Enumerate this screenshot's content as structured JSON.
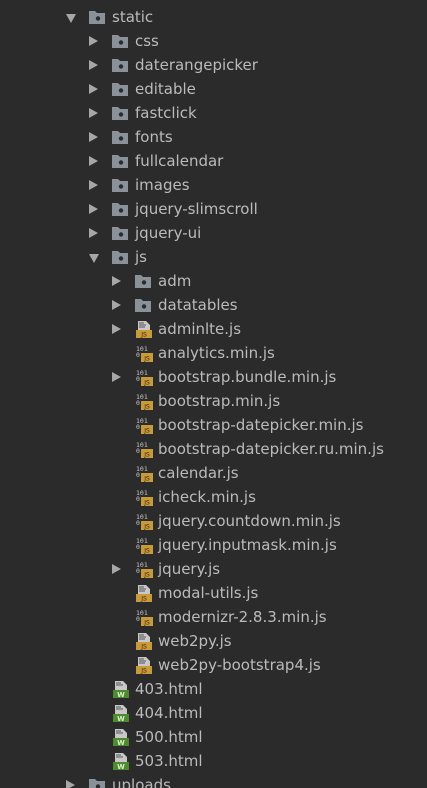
{
  "colors": {
    "background": "#2b2b2b",
    "text": "#bbbbbb",
    "arrow": "#a7a7a7",
    "folder": "#8a9199",
    "js_badge": "#c99a3b",
    "html_badge": "#4e8a2f"
  },
  "rows": [
    {
      "label": "static",
      "type": "folder",
      "state": "expanded",
      "depth": 0,
      "icon": "folder-icon"
    },
    {
      "label": "css",
      "type": "folder",
      "state": "collapsed",
      "depth": 1,
      "icon": "folder-icon"
    },
    {
      "label": "daterangepicker",
      "type": "folder",
      "state": "collapsed",
      "depth": 1,
      "icon": "folder-icon"
    },
    {
      "label": "editable",
      "type": "folder",
      "state": "collapsed",
      "depth": 1,
      "icon": "folder-icon"
    },
    {
      "label": "fastclick",
      "type": "folder",
      "state": "collapsed",
      "depth": 1,
      "icon": "folder-icon"
    },
    {
      "label": "fonts",
      "type": "folder",
      "state": "collapsed",
      "depth": 1,
      "icon": "folder-icon"
    },
    {
      "label": "fullcalendar",
      "type": "folder",
      "state": "collapsed",
      "depth": 1,
      "icon": "folder-icon"
    },
    {
      "label": "images",
      "type": "folder",
      "state": "collapsed",
      "depth": 1,
      "icon": "folder-icon"
    },
    {
      "label": "jquery-slimscroll",
      "type": "folder",
      "state": "collapsed",
      "depth": 1,
      "icon": "folder-icon"
    },
    {
      "label": "jquery-ui",
      "type": "folder",
      "state": "collapsed",
      "depth": 1,
      "icon": "folder-icon"
    },
    {
      "label": "js",
      "type": "folder",
      "state": "expanded",
      "depth": 1,
      "icon": "folder-icon"
    },
    {
      "label": "adm",
      "type": "folder",
      "state": "collapsed",
      "depth": 2,
      "icon": "folder-icon"
    },
    {
      "label": "datatables",
      "type": "folder",
      "state": "collapsed",
      "depth": 2,
      "icon": "folder-icon"
    },
    {
      "label": "adminlte.js",
      "type": "js",
      "state": "collapsed",
      "depth": 2,
      "icon": "js-file-icon"
    },
    {
      "label": "analytics.min.js",
      "type": "minjs",
      "state": "none",
      "depth": 2,
      "icon": "minified-js-file-icon"
    },
    {
      "label": "bootstrap.bundle.min.js",
      "type": "minjs",
      "state": "collapsed",
      "depth": 2,
      "icon": "minified-js-file-icon"
    },
    {
      "label": "bootstrap.min.js",
      "type": "minjs",
      "state": "none",
      "depth": 2,
      "icon": "minified-js-file-icon"
    },
    {
      "label": "bootstrap-datepicker.min.js",
      "type": "minjs",
      "state": "none",
      "depth": 2,
      "icon": "minified-js-file-icon"
    },
    {
      "label": "bootstrap-datepicker.ru.min.js",
      "type": "minjs",
      "state": "none",
      "depth": 2,
      "icon": "minified-js-file-icon"
    },
    {
      "label": "calendar.js",
      "type": "minjs",
      "state": "none",
      "depth": 2,
      "icon": "minified-js-file-icon"
    },
    {
      "label": "icheck.min.js",
      "type": "minjs",
      "state": "none",
      "depth": 2,
      "icon": "minified-js-file-icon"
    },
    {
      "label": "jquery.countdown.min.js",
      "type": "minjs",
      "state": "none",
      "depth": 2,
      "icon": "minified-js-file-icon"
    },
    {
      "label": "jquery.inputmask.min.js",
      "type": "minjs",
      "state": "none",
      "depth": 2,
      "icon": "minified-js-file-icon"
    },
    {
      "label": "jquery.js",
      "type": "minjs",
      "state": "collapsed",
      "depth": 2,
      "icon": "minified-js-file-icon"
    },
    {
      "label": "modal-utils.js",
      "type": "js",
      "state": "none",
      "depth": 2,
      "icon": "js-file-icon"
    },
    {
      "label": "modernizr-2.8.3.min.js",
      "type": "minjs",
      "state": "none",
      "depth": 2,
      "icon": "minified-js-file-icon"
    },
    {
      "label": "web2py.js",
      "type": "js",
      "state": "none",
      "depth": 2,
      "icon": "js-file-icon"
    },
    {
      "label": "web2py-bootstrap4.js",
      "type": "js",
      "state": "none",
      "depth": 2,
      "icon": "js-file-icon"
    },
    {
      "label": "403.html",
      "type": "html",
      "state": "none",
      "depth": 1,
      "icon": "html-file-icon"
    },
    {
      "label": "404.html",
      "type": "html",
      "state": "none",
      "depth": 1,
      "icon": "html-file-icon"
    },
    {
      "label": "500.html",
      "type": "html",
      "state": "none",
      "depth": 1,
      "icon": "html-file-icon"
    },
    {
      "label": "503.html",
      "type": "html",
      "state": "none",
      "depth": 1,
      "icon": "html-file-icon"
    },
    {
      "label": "uploads",
      "type": "folder",
      "state": "collapsed",
      "depth": 0,
      "icon": "folder-icon"
    }
  ]
}
